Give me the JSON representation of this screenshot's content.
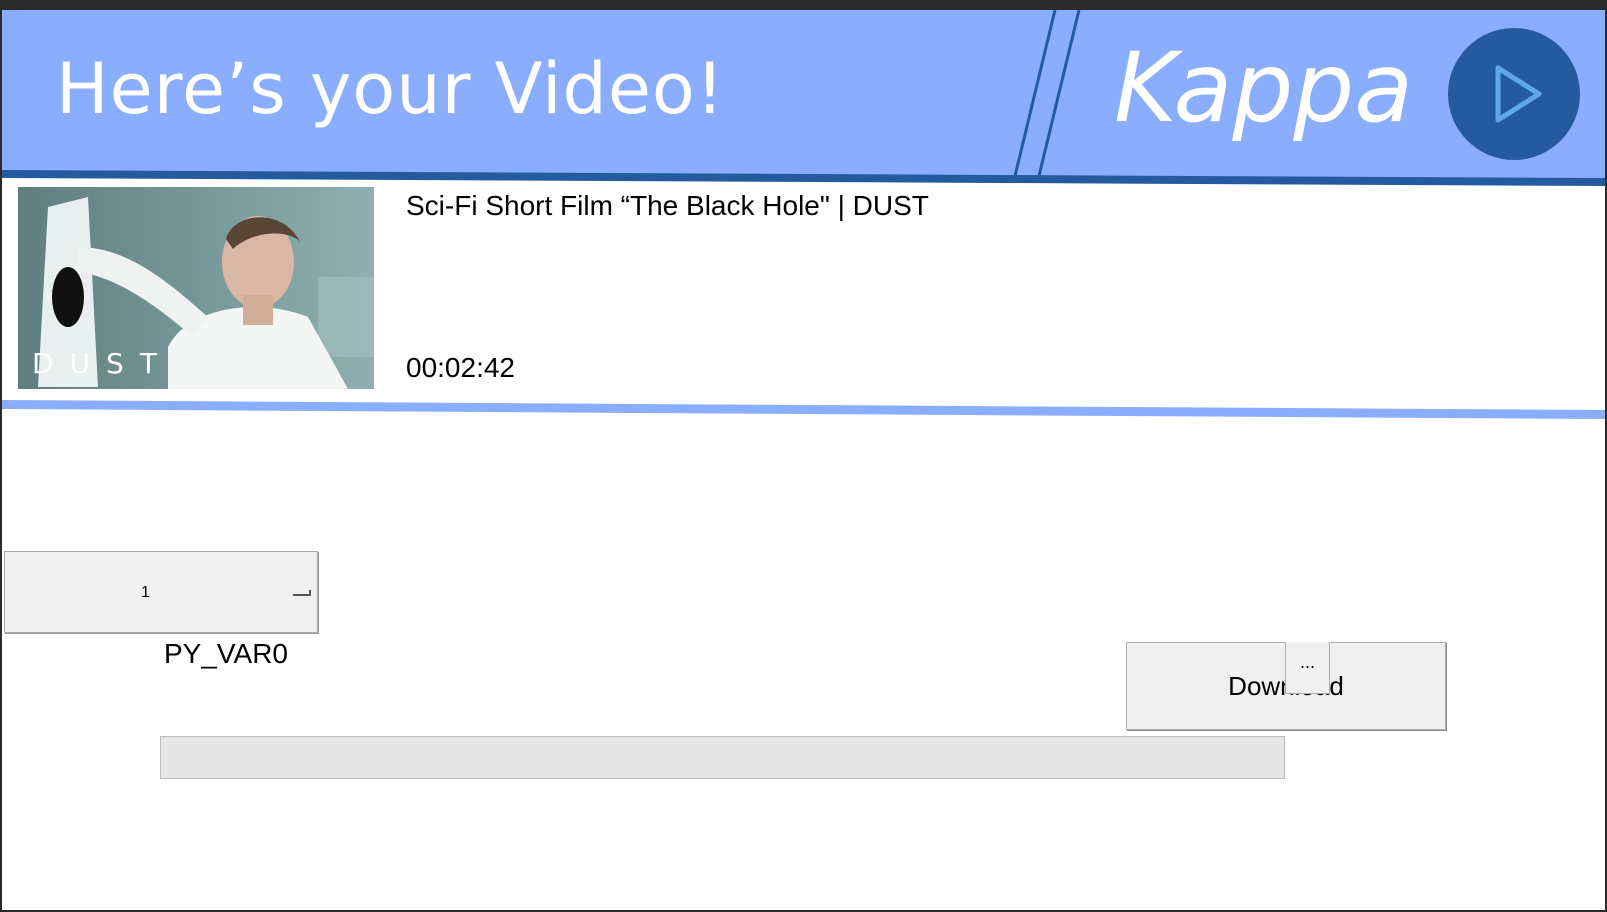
{
  "header": {
    "title": "Here’s your Video!",
    "brand": "Kappa",
    "colors": {
      "banner": "#8aadfd",
      "accent": "#245b9e",
      "text": "#ffffff",
      "divider": "#8aadfd"
    },
    "logo_icon": "play-icon"
  },
  "video": {
    "title": "Sci-Fi Short Film “The Black Hole\" | DUST",
    "duration": "00:02:42",
    "thumbnail_watermark": "DUST"
  },
  "controls": {
    "quality_value": "1",
    "status_label": "PY_VAR0",
    "progress": 0,
    "download_label": "Download",
    "browse_label": "..."
  }
}
